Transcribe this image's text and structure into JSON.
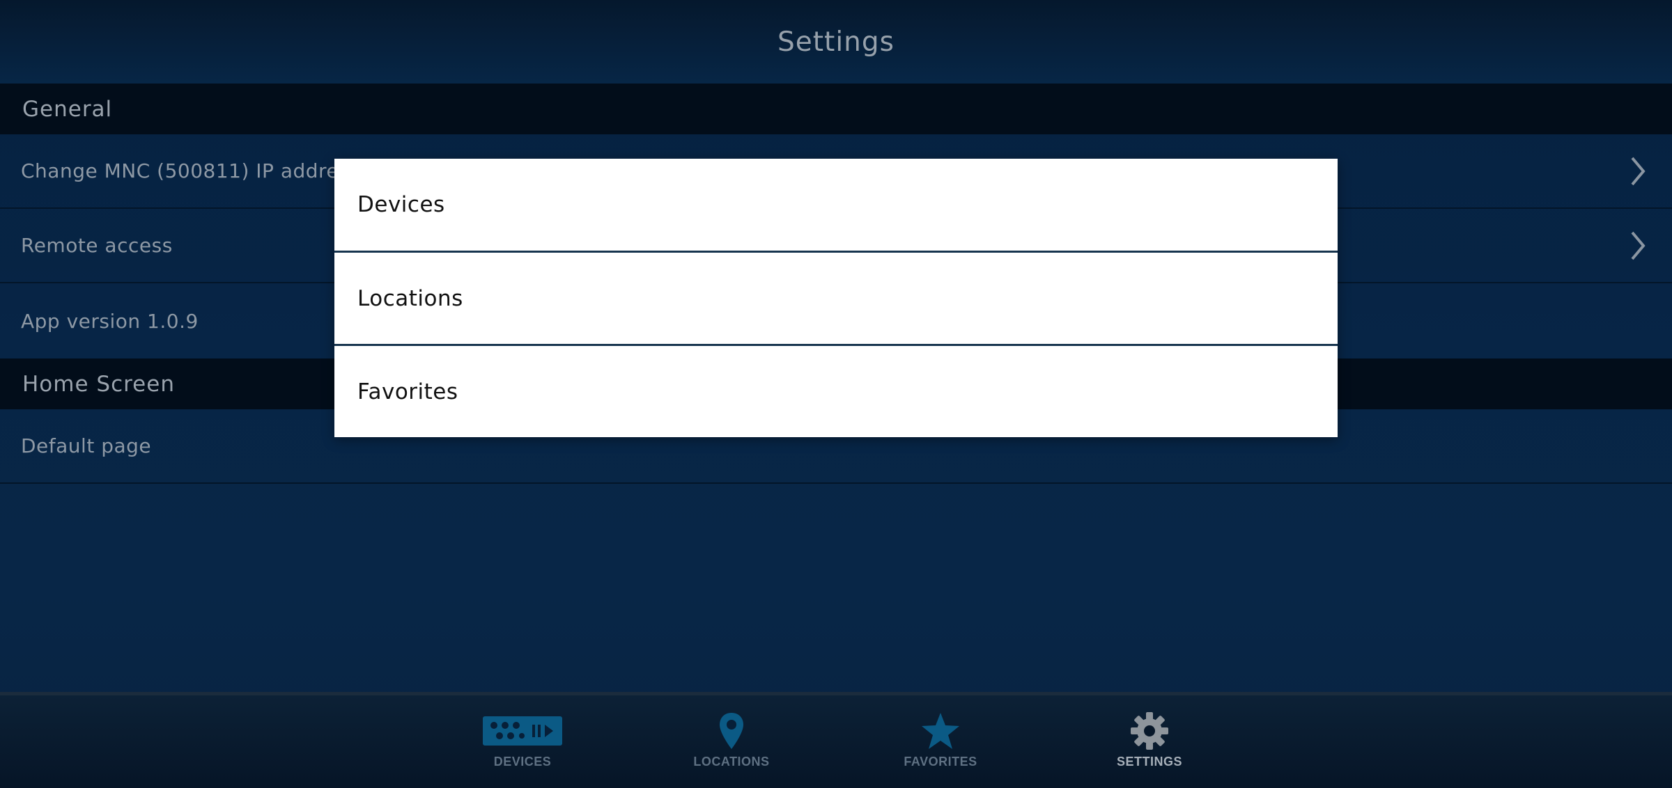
{
  "header": {
    "title": "Settings"
  },
  "sections": {
    "general": {
      "title": "General"
    },
    "home_screen": {
      "title": "Home Screen"
    }
  },
  "rows": {
    "change_ip": {
      "label": "Change MNC (500811) IP address"
    },
    "remote_access": {
      "label": "Remote access"
    },
    "app_version": {
      "label": "App version 1.0.9"
    },
    "default_page": {
      "label": "Default page"
    }
  },
  "dialog": {
    "options": [
      {
        "label": "Devices"
      },
      {
        "label": "Locations"
      },
      {
        "label": "Favorites"
      }
    ]
  },
  "tabbar": {
    "tabs": [
      {
        "label": "DEVICES",
        "icon": "devices-icon",
        "active": false
      },
      {
        "label": "LOCATIONS",
        "icon": "location-pin-icon",
        "active": false
      },
      {
        "label": "FAVORITES",
        "icon": "star-icon",
        "active": false
      },
      {
        "label": "SETTINGS",
        "icon": "gear-icon",
        "active": true
      }
    ]
  },
  "colors": {
    "background": "#072546",
    "section_header": "#020d1a",
    "dialog_background": "#ffffff",
    "tab_inactive_icon": "#0b5a85",
    "tab_active_icon": "#8e959c"
  }
}
